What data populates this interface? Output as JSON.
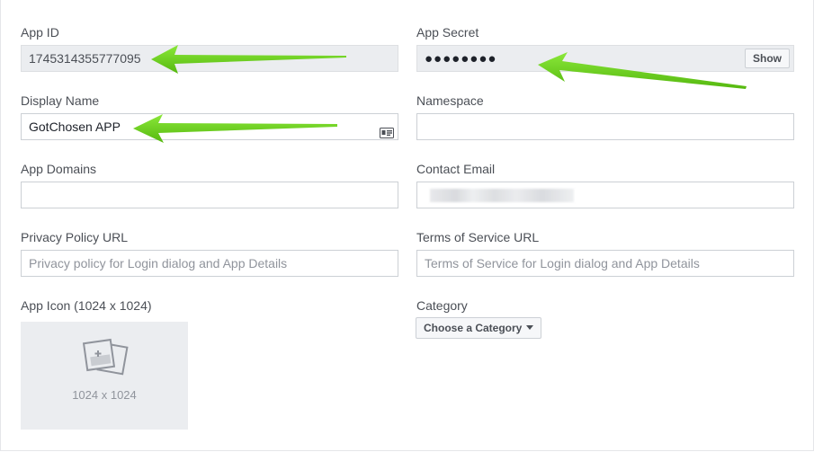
{
  "app_id": {
    "label": "App ID",
    "value": "1745314355777095"
  },
  "app_secret": {
    "label": "App Secret",
    "value": "●●●●●●●●",
    "show_label": "Show"
  },
  "display_name": {
    "label": "Display Name",
    "value": "GotChosen APP"
  },
  "namespace": {
    "label": "Namespace",
    "value": ""
  },
  "app_domains": {
    "label": "App Domains",
    "value": ""
  },
  "contact_email": {
    "label": "Contact Email",
    "value": ""
  },
  "privacy_policy": {
    "label": "Privacy Policy URL",
    "placeholder": "Privacy policy for Login dialog and App Details"
  },
  "terms_of_service": {
    "label": "Terms of Service URL",
    "placeholder": "Terms of Service for Login dialog and App Details"
  },
  "app_icon": {
    "label": "App Icon (1024 x 1024)",
    "size_text": "1024 x 1024",
    "icon": "add-photo-icon"
  },
  "category": {
    "label": "Category",
    "button_label": "Choose a Category",
    "icon": "caret-down-icon"
  },
  "annotations": {
    "arrow_color": "#6fd31f",
    "icon": "green-arrow"
  }
}
